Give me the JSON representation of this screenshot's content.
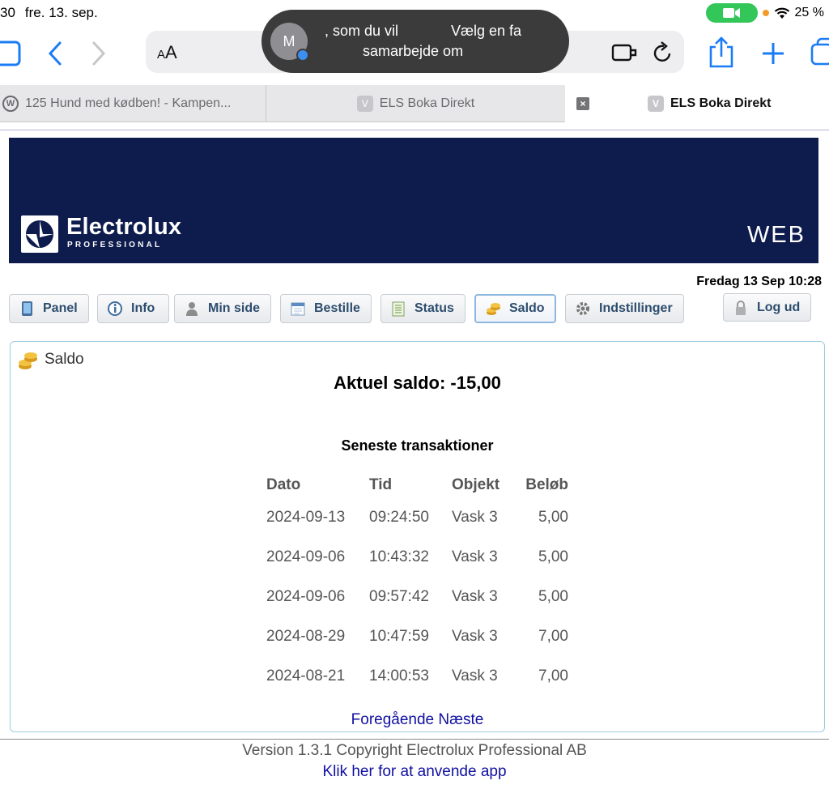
{
  "status_bar": {
    "time": "30",
    "date": "fre. 13. sep.",
    "battery": "25 %"
  },
  "browser": {
    "url_aa_small": "A",
    "url_aa_large": "A",
    "share_toast": {
      "avatar_letter": "M",
      "line1_part1": ", som du vil",
      "line1_part2": "Vælg en fa",
      "line2": "samarbejde om"
    },
    "tabs": [
      {
        "label": "125 Hund med kødben! - Kampen..."
      },
      {
        "favicon": "V",
        "label": "ELS Boka Direkt"
      },
      {
        "favicon": "V",
        "label": "ELS Boka Direkt",
        "close": "×"
      }
    ]
  },
  "banner": {
    "brand": "Electrolux",
    "brand_sub": "PROFESSIONAL",
    "label": "WEB",
    "color": "#0e1b4d"
  },
  "datetime": "Fredag 13 Sep 10:28",
  "nav": [
    {
      "label": "Panel",
      "icon": "tablet-icon"
    },
    {
      "label": "Info",
      "icon": "info-icon"
    },
    {
      "label": "Min side",
      "icon": "user-icon"
    },
    {
      "label": "Bestille",
      "icon": "calendar-icon"
    },
    {
      "label": "Status",
      "icon": "checklist-icon"
    },
    {
      "label": "Saldo",
      "icon": "coins-icon",
      "selected": true
    },
    {
      "label": "Indstillinger",
      "icon": "gear-icon"
    },
    {
      "label": "Log ud",
      "icon": "lock-icon"
    }
  ],
  "panel": {
    "title": "Saldo",
    "balance": "Aktuel saldo: -15,00",
    "transactions_title": "Seneste transaktioner",
    "columns": [
      "Dato",
      "Tid",
      "Objekt",
      "Beløb"
    ],
    "rows": [
      [
        "2024-09-13",
        "09:24:50",
        "Vask 3",
        "5,00"
      ],
      [
        "2024-09-06",
        "10:43:32",
        "Vask 3",
        "5,00"
      ],
      [
        "2024-09-06",
        "09:57:42",
        "Vask 3",
        "5,00"
      ],
      [
        "2024-08-29",
        "10:47:59",
        "Vask 3",
        "7,00"
      ],
      [
        "2024-08-21",
        "14:00:53",
        "Vask 3",
        "7,00"
      ]
    ],
    "prev": "Foregående",
    "next": "Næste"
  },
  "footer": {
    "version": "Version 1.3.1 Copyright Electrolux Professional AB",
    "app_link": "Klik her for at anvende app"
  }
}
